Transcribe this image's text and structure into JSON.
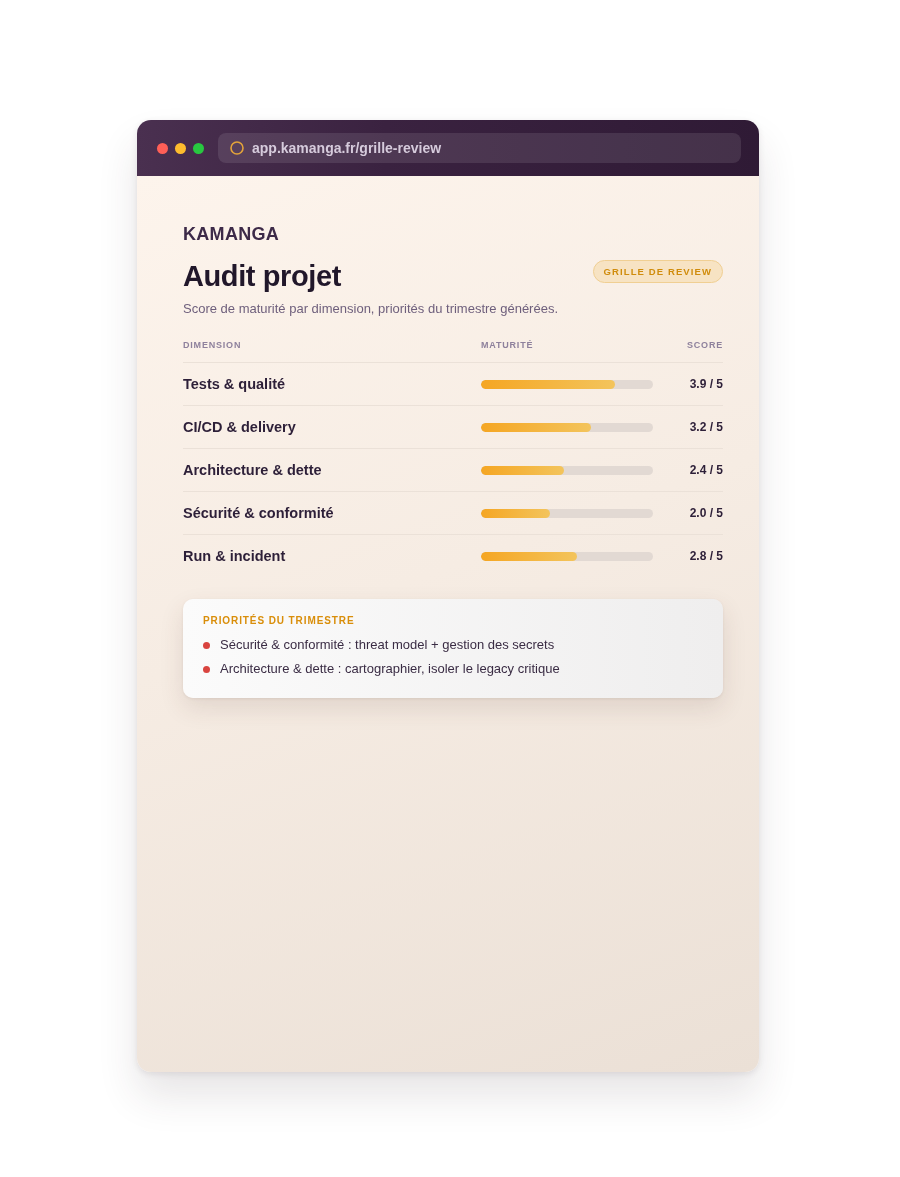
{
  "window": {
    "url": "app.kamanga.fr/grille-review"
  },
  "brand": "KAMANGA",
  "header": {
    "title": "Audit projet",
    "badge": "GRILLE DE REVIEW",
    "subtitle": "Score de maturité par dimension, priorités du trimestre générées."
  },
  "table": {
    "columns": [
      "DIMENSION",
      "MATURITÉ",
      "SCORE"
    ],
    "rows": [
      {
        "dimension": "Tests & qualité",
        "level": 0.78,
        "score": "3.9 / 5"
      },
      {
        "dimension": "CI/CD & delivery",
        "level": 0.64,
        "score": "3.2 / 5"
      },
      {
        "dimension": "Architecture & dette",
        "level": 0.48,
        "score": "2.4 / 5"
      },
      {
        "dimension": "Sécurité & conformité",
        "level": 0.4,
        "score": "2.0 / 5"
      },
      {
        "dimension": "Run & incident",
        "level": 0.56,
        "score": "2.8 / 5"
      }
    ]
  },
  "priorities": {
    "title": "PRIORITÉS DU TRIMESTRE",
    "items": [
      "Sécurité & conformité : threat model + gestion des secrets",
      "Architecture & dette : cartographier, isoler le legacy critique"
    ]
  }
}
